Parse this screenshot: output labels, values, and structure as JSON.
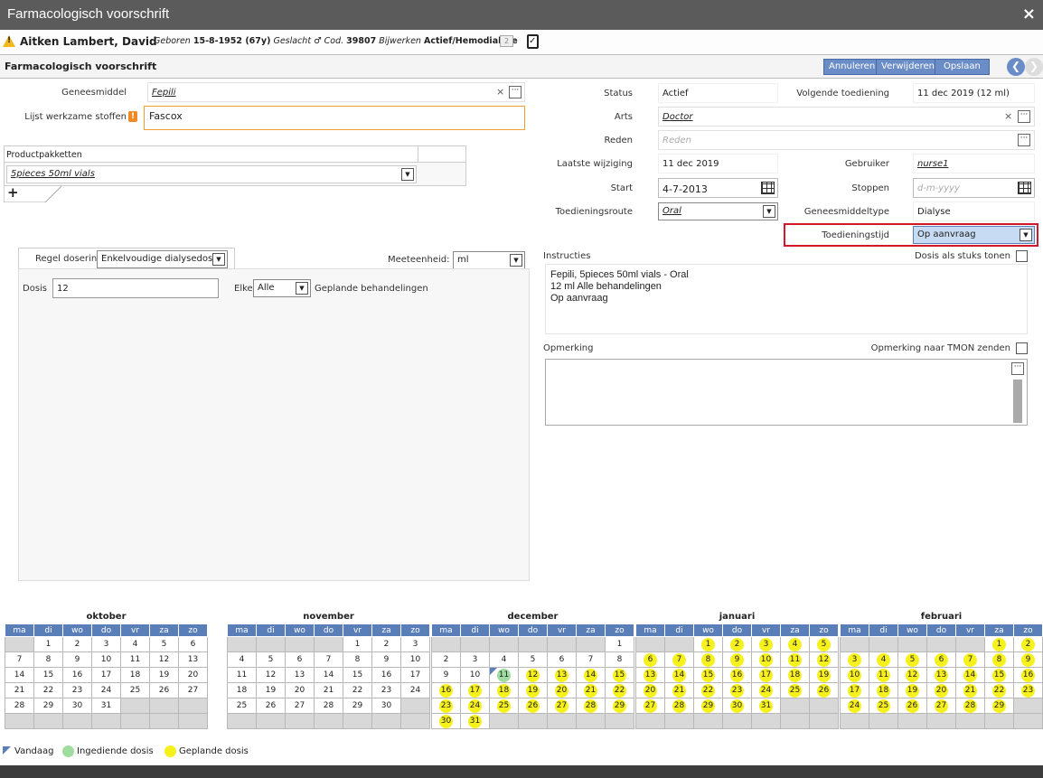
{
  "window": {
    "title": "Farmacologisch voorschrift",
    "close_label": "×"
  },
  "patient": {
    "name": "Aitken Lambert, David",
    "born_label": "Geboren",
    "born_value": "15-8-1952 (67y)",
    "sex_label": "Geslacht",
    "sex_icon": "♂",
    "cod_label": "Cod.",
    "cod_value": "39807",
    "update_label": "Bijwerken",
    "status_value": "Actief/Hemodialyse",
    "tag": "2"
  },
  "toolbar": {
    "section_title": "Farmacologisch voorschrift",
    "cancel_label": "Annuleren",
    "delete_label": "Verwijderen",
    "save_label": "Opslaan",
    "prev": "❮",
    "next": "❯"
  },
  "left": {
    "drug_label": "Geneesmiddel",
    "drug_value": "Fepili",
    "substances_label": "Lijst werkzame stoffen",
    "substances_value": "Fascox",
    "packages_header": "Productpakketten",
    "package_value": "5pieces 50ml vials",
    "add_label": "+"
  },
  "dosing": {
    "rule_label": "Regel dosering",
    "rule_value": "Enkelvoudige dialysedosis",
    "unit_label": "Meeteenheid:",
    "unit_value": "ml",
    "dose_label": "Dosis",
    "dose_value": "12",
    "every_label": "Elke",
    "every_value": "Alle",
    "planned_label": "Geplande behandelingen"
  },
  "right": {
    "status_label": "Status",
    "status_value": "Actief",
    "next_label": "Volgende toediening",
    "next_value": "11 dec 2019 (12 ml)",
    "doctor_label": "Arts",
    "doctor_value": "Doctor",
    "reason_label": "Reden",
    "reason_placeholder": "Reden",
    "lastmod_label": "Laatste wijziging",
    "lastmod_value": "11 dec 2019",
    "user_label": "Gebruiker",
    "user_value": "nurse1",
    "start_label": "Start",
    "start_value": "4-7-2013",
    "stop_label": "Stoppen",
    "stop_placeholder": "d-m-yyyy",
    "route_label": "Toedieningsroute",
    "route_value": "Oral",
    "drugtype_label": "Geneesmiddeltype",
    "drugtype_value": "Dialyse",
    "time_label": "Toedieningstijd",
    "time_value": "Op aanvraag",
    "instructions_label": "Instructies",
    "pieces_label": "Dosis als stuks tonen",
    "instructions_line1": "Fepili, 5pieces 50ml vials  - Oral",
    "instructions_line2": "12 ml Alle behandelingen",
    "instructions_line3": "Op aanvraag",
    "remark_label": "Opmerking",
    "remark_tmon_label": "Opmerking naar TMON zenden"
  },
  "calendar": {
    "weekdays": [
      "ma",
      "di",
      "wo",
      "do",
      "vr",
      "za",
      "zo"
    ],
    "months": [
      {
        "name": "oktober",
        "weeks": [
          [
            "",
            "1",
            "2",
            "3",
            "4",
            "5",
            "6"
          ],
          [
            "7",
            "8",
            "9",
            "10",
            "11",
            "12",
            "13"
          ],
          [
            "14",
            "15",
            "16",
            "17",
            "18",
            "19",
            "20"
          ],
          [
            "21",
            "22",
            "23",
            "24",
            "25",
            "26",
            "27"
          ],
          [
            "28",
            "29",
            "30",
            "31",
            "",
            "",
            ""
          ],
          [
            "",
            "",
            "",
            "",
            "",
            "",
            ""
          ]
        ],
        "planned": [],
        "done": [],
        "today": ""
      },
      {
        "name": "november",
        "weeks": [
          [
            "",
            "",
            "",
            "",
            "1",
            "2",
            "3"
          ],
          [
            "4",
            "5",
            "6",
            "7",
            "8",
            "9",
            "10"
          ],
          [
            "11",
            "12",
            "13",
            "14",
            "15",
            "16",
            "17"
          ],
          [
            "18",
            "19",
            "20",
            "21",
            "22",
            "23",
            "24"
          ],
          [
            "25",
            "26",
            "27",
            "28",
            "29",
            "30",
            ""
          ],
          [
            "",
            "",
            "",
            "",
            "",
            "",
            ""
          ]
        ],
        "planned": [],
        "done": [],
        "today": ""
      },
      {
        "name": "december",
        "weeks": [
          [
            "",
            "",
            "",
            "",
            "",
            "",
            "1"
          ],
          [
            "2",
            "3",
            "4",
            "5",
            "6",
            "7",
            "8"
          ],
          [
            "9",
            "10",
            "11",
            "12",
            "13",
            "14",
            "15"
          ],
          [
            "16",
            "17",
            "18",
            "19",
            "20",
            "21",
            "22"
          ],
          [
            "23",
            "24",
            "25",
            "26",
            "27",
            "28",
            "29"
          ],
          [
            "30",
            "31",
            "",
            "",
            "",
            "",
            ""
          ]
        ],
        "planned": [
          "12",
          "13",
          "14",
          "15",
          "16",
          "17",
          "18",
          "19",
          "20",
          "21",
          "22",
          "23",
          "24",
          "25",
          "26",
          "27",
          "28",
          "29",
          "30",
          "31"
        ],
        "done": [
          "11"
        ],
        "today": "11"
      },
      {
        "name": "januari",
        "weeks": [
          [
            "",
            "",
            "1",
            "2",
            "3",
            "4",
            "5"
          ],
          [
            "6",
            "7",
            "8",
            "9",
            "10",
            "11",
            "12"
          ],
          [
            "13",
            "14",
            "15",
            "16",
            "17",
            "18",
            "19"
          ],
          [
            "20",
            "21",
            "22",
            "23",
            "24",
            "25",
            "26"
          ],
          [
            "27",
            "28",
            "29",
            "30",
            "31",
            "",
            ""
          ],
          [
            "",
            "",
            "",
            "",
            "",
            "",
            ""
          ]
        ],
        "planned": [
          "1",
          "2",
          "3",
          "4",
          "5",
          "6",
          "7",
          "8",
          "9",
          "10",
          "11",
          "12",
          "13",
          "14",
          "15",
          "16",
          "17",
          "18",
          "19",
          "20",
          "21",
          "22",
          "23",
          "24",
          "25",
          "26",
          "27",
          "28",
          "29",
          "30",
          "31"
        ],
        "done": [],
        "today": ""
      },
      {
        "name": "februari",
        "weeks": [
          [
            "",
            "",
            "",
            "",
            "",
            "1",
            "2"
          ],
          [
            "3",
            "4",
            "5",
            "6",
            "7",
            "8",
            "9"
          ],
          [
            "10",
            "11",
            "12",
            "13",
            "14",
            "15",
            "16"
          ],
          [
            "17",
            "18",
            "19",
            "20",
            "21",
            "22",
            "23"
          ],
          [
            "24",
            "25",
            "26",
            "27",
            "28",
            "29",
            ""
          ],
          [
            "",
            "",
            "",
            "",
            "",
            "",
            ""
          ]
        ],
        "planned": [
          "1",
          "2",
          "3",
          "4",
          "5",
          "6",
          "7",
          "8",
          "9",
          "10",
          "11",
          "12",
          "13",
          "14",
          "15",
          "16",
          "17",
          "18",
          "19",
          "20",
          "21",
          "22",
          "23",
          "24",
          "25",
          "26",
          "27",
          "28",
          "29"
        ],
        "done": [],
        "today": ""
      }
    ]
  },
  "legend": {
    "today": "Vandaag",
    "submitted": "Ingediende dosis",
    "planned": "Geplande dosis"
  },
  "colors": {
    "planned": "#f6f01c",
    "done": "#9fdc9f",
    "today": "#5d7fb8",
    "highlight": "#d0182a",
    "button": "#6a8cc7"
  },
  "icons": {
    "warning": "warning-icon",
    "clipboard": "clipboard-check-icon",
    "calendar": "calendar-icon",
    "ellipsis": "ellipsis-icon"
  }
}
